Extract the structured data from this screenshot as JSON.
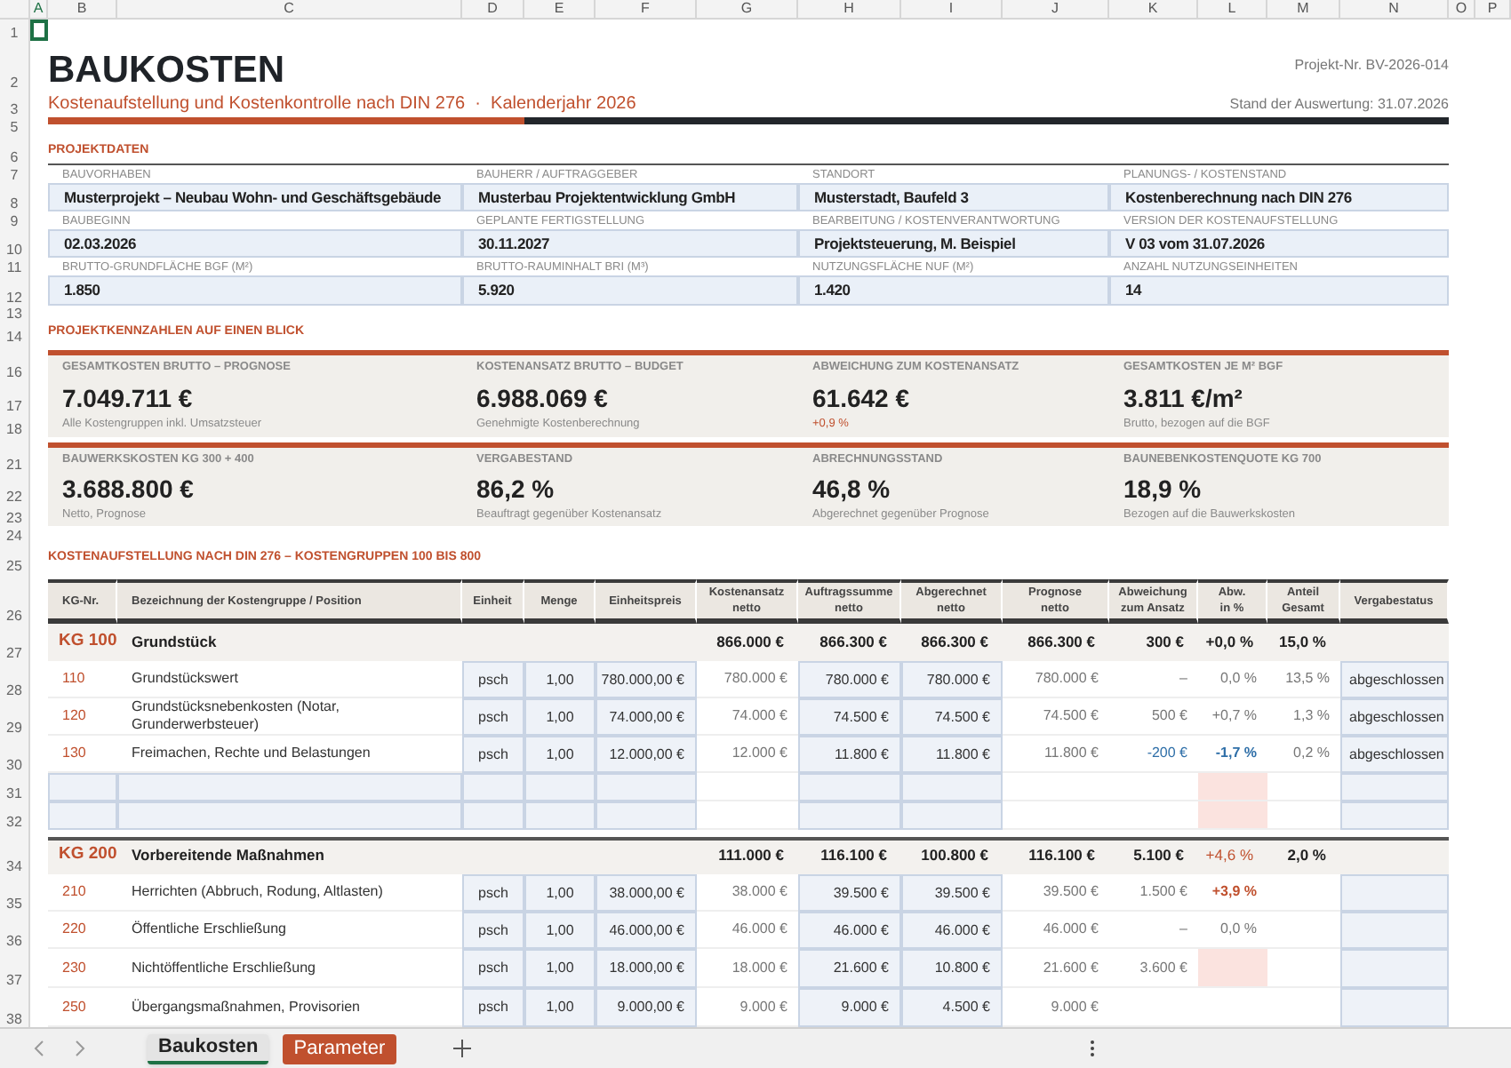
{
  "sheet": {
    "column_letters": [
      "A",
      "B",
      "C",
      "D",
      "E",
      "F",
      "G",
      "H",
      "I",
      "J",
      "K",
      "L",
      "M",
      "N",
      "O",
      "P"
    ],
    "row_numbers": [
      "1",
      "2",
      "3",
      "5",
      "6",
      "7",
      "8",
      "9",
      "10",
      "11",
      "12",
      "13",
      "14",
      "16",
      "17",
      "18",
      "21",
      "22",
      "23",
      "24",
      "25",
      "26",
      "27",
      "28",
      "29",
      "30",
      "31",
      "32",
      "34",
      "35",
      "36",
      "37",
      "38"
    ]
  },
  "title": "BAUKOSTEN",
  "project_number": "Projekt-Nr. BV-2026-014",
  "subtitle": "Kostenaufstellung und Kostenkontrolle nach DIN 276  ·  Kalenderjahr 2026",
  "evaluation_date": "Stand der Auswertung: 31.07.2026",
  "project_data": {
    "heading": "PROJEKTDATEN",
    "rows": [
      [
        {
          "label": "BAUVORHABEN",
          "value": "Musterprojekt – Neubau Wohn- und Geschäftsgebäude"
        },
        {
          "label": "BAUHERR / AUFTRAGGEBER",
          "value": "Musterbau Projektentwicklung GmbH"
        },
        {
          "label": "STANDORT",
          "value": "Musterstadt, Baufeld 3"
        },
        {
          "label": "PLANUNGS- / KOSTENSTAND",
          "value": "Kostenberechnung nach DIN 276"
        }
      ],
      [
        {
          "label": "BAUBEGINN",
          "value": "02.03.2026"
        },
        {
          "label": "GEPLANTE FERTIGSTELLUNG",
          "value": "30.11.2027"
        },
        {
          "label": "BEARBEITUNG / KOSTENVERANTWORTUNG",
          "value": "Projektsteuerung, M. Beispiel"
        },
        {
          "label": "VERSION DER KOSTENAUFSTELLUNG",
          "value": "V 03 vom 31.07.2026"
        }
      ],
      [
        {
          "label": "BRUTTO-GRUNDFLÄCHE BGF (M²)",
          "value": "1.850"
        },
        {
          "label": "BRUTTO-RAUMINHALT BRI (M³)",
          "value": "5.920"
        },
        {
          "label": "NUTZUNGSFLÄCHE NUF (M²)",
          "value": "1.420"
        },
        {
          "label": "ANZAHL NUTZUNGSEINHEITEN",
          "value": "14"
        }
      ]
    ]
  },
  "key_figures": {
    "heading": "PROJEKTKENNZAHLEN AUF EINEN BLICK",
    "panels": [
      [
        {
          "label": "GESAMTKOSTEN BRUTTO – PROGNOSE",
          "value": "7.049.711 €",
          "note": "Alle Kostengruppen inkl. Umsatzsteuer",
          "note_highlight": false
        },
        {
          "label": "KOSTENANSATZ BRUTTO – BUDGET",
          "value": "6.988.069 €",
          "note": "Genehmigte Kostenberechnung",
          "note_highlight": false
        },
        {
          "label": "ABWEICHUNG ZUM KOSTENANSATZ",
          "value": "61.642 €",
          "note": "+0,9 %",
          "note_highlight": true
        },
        {
          "label": "GESAMTKOSTEN JE M² BGF",
          "value": "3.811 €/m²",
          "note": "Brutto, bezogen auf die BGF",
          "note_highlight": false
        }
      ],
      [
        {
          "label": "BAUWERKSKOSTEN KG 300 + 400",
          "value": "3.688.800 €",
          "note": "Netto, Prognose",
          "note_highlight": false
        },
        {
          "label": "VERGABESTAND",
          "value": "86,2 %",
          "note": "Beauftragt gegenüber Kostenansatz",
          "note_highlight": false
        },
        {
          "label": "ABRECHNUNGSSTAND",
          "value": "46,8 %",
          "note": "Abgerechnet gegenüber Prognose",
          "note_highlight": false
        },
        {
          "label": "BAUNEBENKOSTENQUOTE KG 700",
          "value": "18,9 %",
          "note": "Bezogen auf die Bauwerkskosten",
          "note_highlight": false
        }
      ]
    ]
  },
  "cost_table": {
    "heading": "KOSTENAUFSTELLUNG NACH DIN 276 – KOSTENGRUPPEN 100 BIS 800",
    "columns": [
      "KG-Nr.",
      "Bezeichnung der Kostengruppe / Position",
      "Einheit",
      "Menge",
      "Einheitspreis",
      "Kostenansatz\nnetto",
      "Auftragssumme\nnetto",
      "Abgerechnet\nnetto",
      "Prognose\nnetto",
      "Abweichung\nzum Ansatz",
      "Abw.\nin %",
      "Anteil\nGesamt",
      "Vergabestatus"
    ],
    "groups": [
      {
        "kg": "KG 100",
        "name": "Grundstück",
        "budget": "866.000 €",
        "awarded": "866.300 €",
        "billed": "866.300 €",
        "forecast": "866.300 €",
        "deviation": "300 €",
        "deviation_pct": "+0,0 %",
        "share": "15,0 %",
        "rows": [
          {
            "kind": "position",
            "kg": "110",
            "name": "Grundstückswert",
            "unit": "psch",
            "qty": "1,00",
            "unit_price": "780.000,00 €",
            "budget": "780.000 €",
            "awarded": "780.000 €",
            "billed": "780.000 €",
            "forecast": "780.000 €",
            "deviation": "–",
            "deviation_pct": "0,0 %",
            "share": "13,5 %",
            "status": "abgeschlossen",
            "alert": false
          },
          {
            "kind": "position",
            "kg": "120",
            "name": "Grundstücksnebenkosten (Notar, Grunderwerbsteuer)",
            "unit": "psch",
            "qty": "1,00",
            "unit_price": "74.000,00 €",
            "budget": "74.000 €",
            "awarded": "74.500 €",
            "billed": "74.500 €",
            "forecast": "74.500 €",
            "deviation": "500 €",
            "deviation_pct": "+0,7 %",
            "share": "1,3 %",
            "status": "abgeschlossen",
            "alert": false
          },
          {
            "kind": "position",
            "kg": "130",
            "name": "Freimachen, Rechte und Belastungen",
            "unit": "psch",
            "qty": "1,00",
            "unit_price": "12.000,00 €",
            "budget": "12.000 €",
            "awarded": "11.800 €",
            "billed": "11.800 €",
            "forecast": "11.800 €",
            "deviation": "-200 €",
            "deviation_pct": "-1,7 %",
            "share": "0,2 %",
            "status": "abgeschlossen",
            "color": "#2f6fa8",
            "amount_highlight": true,
            "alert": false
          },
          {
            "kind": "empty",
            "alert": true
          },
          {
            "kind": "empty",
            "alert": true
          }
        ]
      },
      {
        "kg": "KG 200",
        "name": "Vorbereitende Maßnahmen",
        "budget": "111.000 €",
        "awarded": "116.100 €",
        "billed": "100.800 €",
        "forecast": "116.100 €",
        "deviation": "5.100 €",
        "deviation_pct": "+4,6 %",
        "share": "2,0 %",
        "color": "#c0502e",
        "rows": [
          {
            "kind": "position",
            "kg": "210",
            "name": "Herrichten (Abbruch, Rodung, Altlasten)",
            "unit": "psch",
            "qty": "1,00",
            "unit_price": "38.000,00 €",
            "budget": "38.000 €",
            "awarded": "39.500 €",
            "billed": "39.500 €",
            "forecast": "39.500 €",
            "deviation": "1.500 €",
            "deviation_pct": "+3,9 %",
            "color": "#c0502e",
            "amount_highlight": false,
            "alert": false
          },
          {
            "kind": "position",
            "kg": "220",
            "name": "Öffentliche Erschließung",
            "unit": "psch",
            "qty": "1,00",
            "unit_price": "46.000,00 €",
            "budget": "46.000 €",
            "awarded": "46.000 €",
            "billed": "46.000 €",
            "forecast": "46.000 €",
            "deviation": "–",
            "deviation_pct": "0,0 %",
            "alert": false
          },
          {
            "kind": "position",
            "kg": "230",
            "name": "Nichtöffentliche Erschließung",
            "unit": "psch",
            "qty": "1,00",
            "unit_price": "18.000,00 €",
            "budget": "18.000 €",
            "awarded": "21.600 €",
            "billed": "10.800 €",
            "forecast": "21.600 €",
            "deviation": "3.600 €",
            "alert": true
          },
          {
            "kind": "position",
            "kg": "250",
            "name": "Übergangsmaßnahmen, Provisorien",
            "unit": "psch",
            "qty": "1,00",
            "unit_price": "9.000,00 €",
            "budget": "9.000 €",
            "awarded": "9.000 €",
            "billed": "4.500 €",
            "forecast": "9.000 €",
            "alert": false
          }
        ]
      }
    ]
  },
  "sheet_tabs": [
    {
      "label": "Baukosten",
      "selected": true
    },
    {
      "label": "Parameter",
      "selected": false,
      "color": "#c0502e"
    }
  ]
}
